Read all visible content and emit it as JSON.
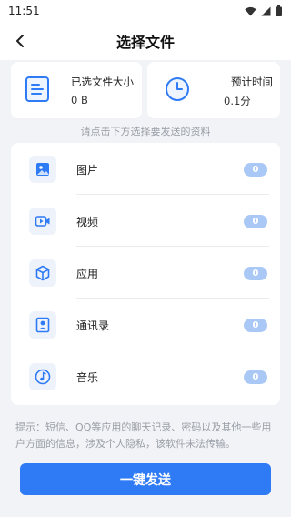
{
  "status_bar": {
    "time": "11:51"
  },
  "header": {
    "title": "选择文件"
  },
  "summary": {
    "selected_size_label": "已选文件大小",
    "selected_size_value": "0 B",
    "estimated_time_label": "预计时间",
    "estimated_time_value": "0.1分"
  },
  "instruction": "请点击下方选择要发送的资料",
  "categories": [
    {
      "label": "图片",
      "count": "0",
      "icon": "image-icon"
    },
    {
      "label": "视频",
      "count": "0",
      "icon": "video-icon"
    },
    {
      "label": "应用",
      "count": "0",
      "icon": "app-cube-icon"
    },
    {
      "label": "通讯录",
      "count": "0",
      "icon": "contact-card-icon"
    },
    {
      "label": "音乐",
      "count": "0",
      "icon": "music-note-icon"
    }
  ],
  "notice": "提示：短信、QQ等应用的聊天记录、密码以及其他一些用户方面的信息，涉及个人隐私，该软件未法传输。",
  "send_button_label": "一键发送",
  "colors": {
    "accent": "#2f7bf6",
    "badge": "#a9c8f5",
    "background": "#f1f3f7"
  }
}
